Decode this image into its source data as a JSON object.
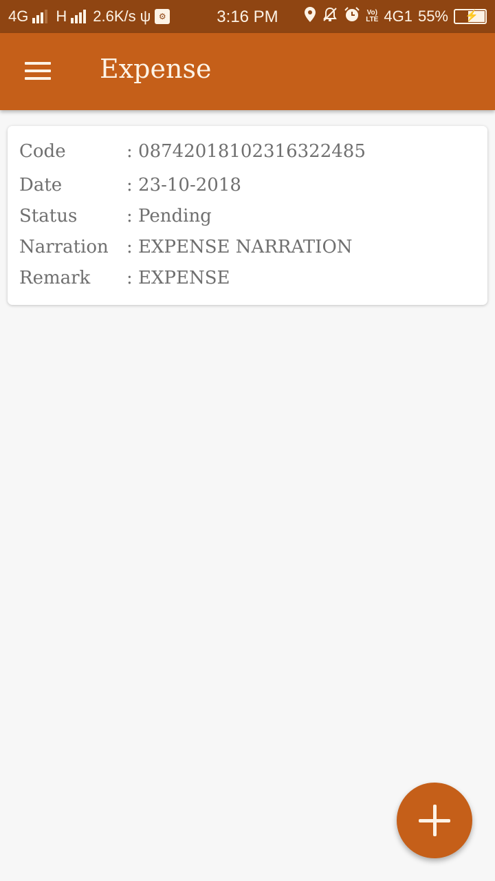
{
  "status_bar": {
    "network1": "4G",
    "network2": "H",
    "speed": "2.6K/s",
    "time": "3:16 PM",
    "volte": "Vo) LTE",
    "network3": "4G1",
    "battery": "55%",
    "icons": [
      "signal-icon",
      "usb-icon",
      "usb-debug-icon",
      "location-icon",
      "notifications-off-icon",
      "alarm-icon",
      "volte-icon",
      "battery-charging-icon"
    ]
  },
  "app_bar": {
    "title": "Expense",
    "menu_icon": "hamburger-menu-icon"
  },
  "expense_card": {
    "rows": [
      {
        "label": "Code",
        "value": ": 08742018102316322485"
      },
      {
        "label": "Date",
        "value": ": 23-10-2018"
      },
      {
        "label": "Status",
        "value": ": Pending"
      },
      {
        "label": "Narration",
        "value": ": EXPENSE NARRATION"
      },
      {
        "label": "Remark",
        "value": ": EXPENSE"
      }
    ]
  },
  "fab": {
    "icon": "plus-icon",
    "color": "#c55f19"
  },
  "colors": {
    "app_bar": "#c55f19",
    "status_bar": "#8f4512",
    "background": "#f7f7f7",
    "text": "#6f6f6f"
  }
}
